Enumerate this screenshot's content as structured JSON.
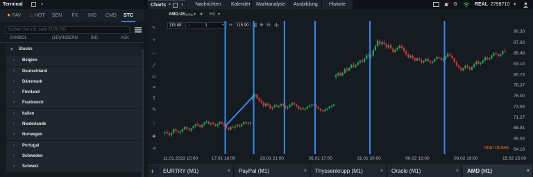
{
  "terminal": {
    "title": "Terminal"
  },
  "left_tabs": [
    {
      "label": "FAV",
      "icon": "star-icon"
    },
    {
      "label": "HOT",
      "icon": "flame-icon"
    },
    {
      "label": "SEN"
    },
    {
      "label": "FX"
    },
    {
      "label": "IND"
    },
    {
      "label": "CMD"
    },
    {
      "label": "STC",
      "active": true
    }
  ],
  "search": {
    "placeholder": "Suchen Sie z.B. nach EURUSD"
  },
  "columns": [
    "SYMBOL",
    "(1D)ÄNDERN",
    "BID",
    "ASK"
  ],
  "list": {
    "header": "Stocks",
    "items": [
      "Belgien",
      "Deutschland",
      "Dänemark",
      "Finnland",
      "Frankreich",
      "Italien",
      "Niederlande",
      "Norwegen",
      "Portugal",
      "Schweden",
      "Schweiz"
    ]
  },
  "charts_window": {
    "title": "Charts"
  },
  "menu": [
    "Nachrichten",
    "Kalender",
    "Marktanalyse",
    "Ausbildung",
    "Historie"
  ],
  "account": {
    "label": "REAL",
    "number": "2798710"
  },
  "chart_header": {
    "symbol": "AMD.US",
    "symbol_suffix": "WMc",
    "timeframe": "H1"
  },
  "ticket": {
    "sell_price": "115.88",
    "volume": "1",
    "buy_price": "115.90"
  },
  "timer": "00m 00Sek",
  "bottom_tabs": [
    {
      "label": "EURTRY (M1)"
    },
    {
      "label": "PayPal (M1)"
    },
    {
      "label": "Thyssenkrupp (M1)"
    },
    {
      "label": "Oracle (M1)"
    },
    {
      "label": "AMD (H1)",
      "active": true
    }
  ],
  "colors": {
    "bull": "#1ea75a",
    "bear": "#d8323a",
    "vline": "#2f8ef0",
    "accent": "#2f80ed",
    "timer": "#e07b1c"
  },
  "chart_data": {
    "type": "candlestick",
    "symbol": "AMD.US",
    "timeframe": "H1",
    "y_ticks": [
      90.3,
      87.83,
      85.46,
      83.1,
      80.73,
      78.37,
      76.0,
      73.64,
      71.27,
      68.91,
      66.54,
      64.18
    ],
    "ylim": [
      64.18,
      90.3
    ],
    "x_ticks": [
      "11.01.2023 15:00",
      "17.01 18:00",
      "20.01 21:00",
      "26.01 17:00",
      "31.01 20:00",
      "06.02 16:00",
      "09.02 19:00",
      "15.02 15:00"
    ],
    "vertical_lines_at_candle": [
      28,
      41,
      55,
      69,
      94,
      128
    ],
    "trendline": {
      "from": {
        "candle": 28,
        "price": 69.3
      },
      "to": {
        "candle": 41,
        "price": 76.0
      }
    },
    "candles_ohlc": [
      [
        67.8,
        68.3,
        67.2,
        68.0
      ],
      [
        68.0,
        68.6,
        67.5,
        67.7
      ],
      [
        67.7,
        68.1,
        67.0,
        67.3
      ],
      [
        67.3,
        67.9,
        66.9,
        67.8
      ],
      [
        67.8,
        68.9,
        67.6,
        68.6
      ],
      [
        68.6,
        69.0,
        68.0,
        68.2
      ],
      [
        68.2,
        68.5,
        67.6,
        67.9
      ],
      [
        67.9,
        68.4,
        67.4,
        68.1
      ],
      [
        68.1,
        68.8,
        67.9,
        68.6
      ],
      [
        68.6,
        69.3,
        68.4,
        69.1
      ],
      [
        69.1,
        69.4,
        68.5,
        68.7
      ],
      [
        68.7,
        69.0,
        68.2,
        68.4
      ],
      [
        68.4,
        68.9,
        68.0,
        68.8
      ],
      [
        68.8,
        69.5,
        68.6,
        69.3
      ],
      [
        69.3,
        69.9,
        69.0,
        69.7
      ],
      [
        69.7,
        70.1,
        69.2,
        69.5
      ],
      [
        69.5,
        69.8,
        68.9,
        69.1
      ],
      [
        69.1,
        69.7,
        68.8,
        69.6
      ],
      [
        69.6,
        70.3,
        69.4,
        70.1
      ],
      [
        70.1,
        70.6,
        69.8,
        70.3
      ],
      [
        70.3,
        70.5,
        69.6,
        69.8
      ],
      [
        69.8,
        70.2,
        69.3,
        70.0
      ],
      [
        70.0,
        70.4,
        69.6,
        69.7
      ],
      [
        69.7,
        70.0,
        69.1,
        69.4
      ],
      [
        69.4,
        69.9,
        69.0,
        69.8
      ],
      [
        69.8,
        70.4,
        69.5,
        70.2
      ],
      [
        70.2,
        70.5,
        69.7,
        69.9
      ],
      [
        69.9,
        70.1,
        69.2,
        69.4
      ],
      [
        69.4,
        69.7,
        68.6,
        68.9
      ],
      [
        68.9,
        69.2,
        68.2,
        68.5
      ],
      [
        68.5,
        69.3,
        68.3,
        69.1
      ],
      [
        69.1,
        69.6,
        68.8,
        69.0
      ],
      [
        69.0,
        69.4,
        68.5,
        69.3
      ],
      [
        69.3,
        69.8,
        69.0,
        69.6
      ],
      [
        69.6,
        69.8,
        69.0,
        69.2
      ],
      [
        69.2,
        69.9,
        69.0,
        69.7
      ],
      [
        69.7,
        70.4,
        69.5,
        70.2
      ],
      [
        70.2,
        70.5,
        69.6,
        69.9
      ],
      [
        69.9,
        70.2,
        69.4,
        70.1
      ],
      [
        70.1,
        70.3,
        69.5,
        69.8
      ],
      [
        75.6,
        76.2,
        75.0,
        75.9
      ],
      [
        75.9,
        76.6,
        75.4,
        76.3
      ],
      [
        76.3,
        76.5,
        75.2,
        75.5
      ],
      [
        75.5,
        75.8,
        74.6,
        74.9
      ],
      [
        74.9,
        75.3,
        74.2,
        74.5
      ],
      [
        74.5,
        74.9,
        73.4,
        73.7
      ],
      [
        73.7,
        74.5,
        73.5,
        74.3
      ],
      [
        74.3,
        74.6,
        73.6,
        73.9
      ],
      [
        73.9,
        74.2,
        72.9,
        73.2
      ],
      [
        73.2,
        73.6,
        72.8,
        73.5
      ],
      [
        73.5,
        74.1,
        73.3,
        73.9
      ],
      [
        73.9,
        74.3,
        73.4,
        73.6
      ],
      [
        73.6,
        74.0,
        73.2,
        73.8
      ],
      [
        73.8,
        74.4,
        73.5,
        74.2
      ],
      [
        74.2,
        74.5,
        73.6,
        73.8
      ],
      [
        73.8,
        74.0,
        73.1,
        73.4
      ],
      [
        73.4,
        73.8,
        72.9,
        73.6
      ],
      [
        73.6,
        74.2,
        73.3,
        74.0
      ],
      [
        74.0,
        74.6,
        73.7,
        74.4
      ],
      [
        74.4,
        74.7,
        73.9,
        74.1
      ],
      [
        74.1,
        74.3,
        73.4,
        73.7
      ],
      [
        73.7,
        73.9,
        72.8,
        73.1
      ],
      [
        73.1,
        73.5,
        72.7,
        73.3
      ],
      [
        73.3,
        73.6,
        72.9,
        73.0
      ],
      [
        73.0,
        73.4,
        72.6,
        73.2
      ],
      [
        73.2,
        73.8,
        73.0,
        73.6
      ],
      [
        73.6,
        74.1,
        73.3,
        73.9
      ],
      [
        73.9,
        74.3,
        73.5,
        74.1
      ],
      [
        74.1,
        74.4,
        73.7,
        73.9
      ],
      [
        73.9,
        74.1,
        73.3,
        73.5
      ],
      [
        73.5,
        73.7,
        72.9,
        73.1
      ],
      [
        73.1,
        73.3,
        72.5,
        72.8
      ],
      [
        72.8,
        73.0,
        72.3,
        72.6
      ],
      [
        72.6,
        73.2,
        72.4,
        73.0
      ],
      [
        73.0,
        73.4,
        72.7,
        73.2
      ],
      [
        73.2,
        73.8,
        73.0,
        73.6
      ],
      [
        73.6,
        74.0,
        73.3,
        73.8
      ],
      [
        73.8,
        74.3,
        73.6,
        74.1
      ],
      [
        80.2,
        80.9,
        79.6,
        80.6
      ],
      [
        80.6,
        81.3,
        80.2,
        81.0
      ],
      [
        81.0,
        81.5,
        80.3,
        80.5
      ],
      [
        80.5,
        81.2,
        80.3,
        81.1
      ],
      [
        81.1,
        82.2,
        80.9,
        81.9
      ],
      [
        81.9,
        82.5,
        81.3,
        81.6
      ],
      [
        81.6,
        82.4,
        81.4,
        82.2
      ],
      [
        82.2,
        83.1,
        82.0,
        82.9
      ],
      [
        82.9,
        83.4,
        82.2,
        82.5
      ],
      [
        82.5,
        83.0,
        82.1,
        82.8
      ],
      [
        82.8,
        83.6,
        82.6,
        83.4
      ],
      [
        83.4,
        84.1,
        83.1,
        83.8
      ],
      [
        83.8,
        84.3,
        83.2,
        83.5
      ],
      [
        83.5,
        84.4,
        83.3,
        84.2
      ],
      [
        84.2,
        85.3,
        84.0,
        85.0
      ],
      [
        85.0,
        85.6,
        84.4,
        84.7
      ],
      [
        84.7,
        85.2,
        84.2,
        84.9
      ],
      [
        84.9,
        86.4,
        84.7,
        86.1
      ],
      [
        86.1,
        87.3,
        85.9,
        87.0
      ],
      [
        87.0,
        88.6,
        86.8,
        88.2
      ],
      [
        88.2,
        88.6,
        87.1,
        87.4
      ],
      [
        87.4,
        88.2,
        87.0,
        87.9
      ],
      [
        87.9,
        88.5,
        87.2,
        87.5
      ],
      [
        87.5,
        87.8,
        86.4,
        86.7
      ],
      [
        86.7,
        87.5,
        86.5,
        87.2
      ],
      [
        87.2,
        87.6,
        86.2,
        86.5
      ],
      [
        86.5,
        86.8,
        85.4,
        85.7
      ],
      [
        85.7,
        86.4,
        85.5,
        86.2
      ],
      [
        86.2,
        86.9,
        85.9,
        86.6
      ],
      [
        86.6,
        87.3,
        86.4,
        87.1
      ],
      [
        87.1,
        87.4,
        86.3,
        86.6
      ],
      [
        86.6,
        86.9,
        85.6,
        85.9
      ],
      [
        85.9,
        86.2,
        84.9,
        85.2
      ],
      [
        85.2,
        85.5,
        84.2,
        84.5
      ],
      [
        84.5,
        85.1,
        84.3,
        84.9
      ],
      [
        84.9,
        85.2,
        84.0,
        84.3
      ],
      [
        84.3,
        84.6,
        83.5,
        83.8
      ],
      [
        83.8,
        84.5,
        83.6,
        84.3
      ],
      [
        84.3,
        84.6,
        83.7,
        84.0
      ],
      [
        84.0,
        84.3,
        83.1,
        83.4
      ],
      [
        83.4,
        83.9,
        83.2,
        83.7
      ],
      [
        83.7,
        84.4,
        83.5,
        84.2
      ],
      [
        84.2,
        84.5,
        83.5,
        83.7
      ],
      [
        83.7,
        84.0,
        83.1,
        83.3
      ],
      [
        83.3,
        83.8,
        83.0,
        83.6
      ],
      [
        83.6,
        84.3,
        83.4,
        84.1
      ],
      [
        84.1,
        84.8,
        83.9,
        84.6
      ],
      [
        84.6,
        85.0,
        84.1,
        84.4
      ],
      [
        84.4,
        84.7,
        83.7,
        84.0
      ],
      [
        84.0,
        84.4,
        83.5,
        84.2
      ],
      [
        84.2,
        84.9,
        84.0,
        84.7
      ],
      [
        84.7,
        85.6,
        84.5,
        85.3
      ],
      [
        85.3,
        85.7,
        84.6,
        84.9
      ],
      [
        84.9,
        85.1,
        84.0,
        84.3
      ],
      [
        84.3,
        84.5,
        83.2,
        83.5
      ],
      [
        83.5,
        83.8,
        82.4,
        82.7
      ],
      [
        82.7,
        83.1,
        81.9,
        82.2
      ],
      [
        82.2,
        82.5,
        81.3,
        81.6
      ],
      [
        81.6,
        82.3,
        81.4,
        82.1
      ],
      [
        82.1,
        82.9,
        81.9,
        82.7
      ],
      [
        82.7,
        83.0,
        82.0,
        82.3
      ],
      [
        82.3,
        82.6,
        81.5,
        81.8
      ],
      [
        81.8,
        82.5,
        81.6,
        82.4
      ],
      [
        82.4,
        83.2,
        82.2,
        83.0
      ],
      [
        83.0,
        83.8,
        82.8,
        83.6
      ],
      [
        83.6,
        83.9,
        82.9,
        83.1
      ],
      [
        83.1,
        83.5,
        82.7,
        83.3
      ],
      [
        83.3,
        84.0,
        83.1,
        83.8
      ],
      [
        83.8,
        84.8,
        83.6,
        84.5
      ],
      [
        84.5,
        84.9,
        83.9,
        84.1
      ],
      [
        84.1,
        84.5,
        83.8,
        84.3
      ],
      [
        84.3,
        85.1,
        84.1,
        84.9
      ],
      [
        84.9,
        85.7,
        84.7,
        85.4
      ],
      [
        85.4,
        86.0,
        85.0,
        85.2
      ],
      [
        85.2,
        85.5,
        84.5,
        84.8
      ],
      [
        84.8,
        85.4,
        84.6,
        85.2
      ],
      [
        85.2,
        86.1,
        85.0,
        85.9
      ],
      [
        85.9,
        86.5,
        85.5,
        85.7
      ]
    ]
  }
}
